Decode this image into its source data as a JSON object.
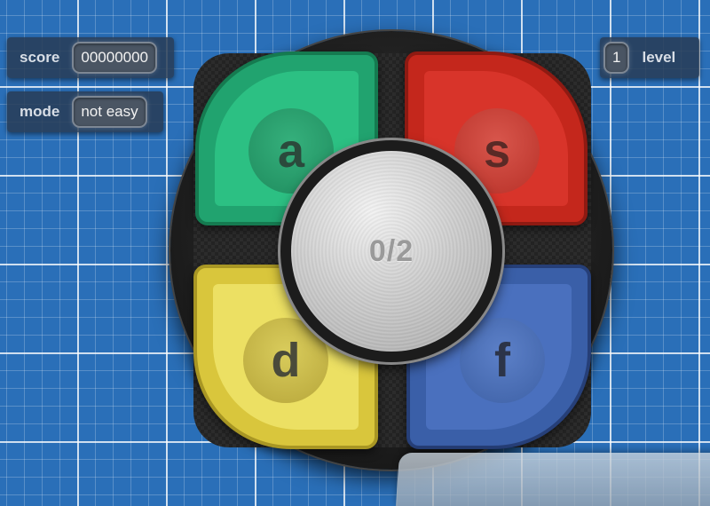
{
  "hud": {
    "score_label": "score",
    "score_value": "00000000",
    "mode_label": "mode",
    "mode_value": "not easy",
    "level_value": "1",
    "level_label": "level"
  },
  "pads": [
    {
      "key": "a",
      "color": "#21a36f"
    },
    {
      "key": "s",
      "color": "#c4271c"
    },
    {
      "key": "d",
      "color": "#d9c63c"
    },
    {
      "key": "f",
      "color": "#3a5fa8"
    }
  ],
  "center": {
    "progress": "0/2"
  }
}
